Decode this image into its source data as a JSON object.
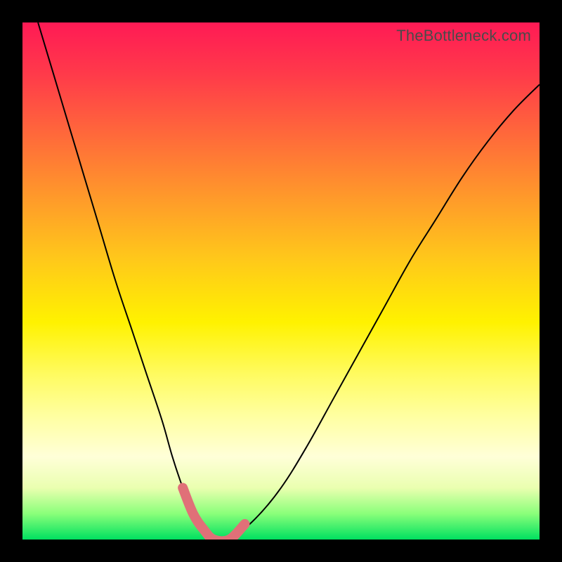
{
  "watermark": "TheBottleneck.com",
  "chart_data": {
    "type": "line",
    "title": "",
    "xlabel": "",
    "ylabel": "",
    "xlim": [
      0,
      100
    ],
    "ylim": [
      0,
      100
    ],
    "series": [
      {
        "name": "bottleneck-curve",
        "x": [
          3,
          6,
          9,
          12,
          15,
          18,
          21,
          24,
          27,
          29,
          31,
          33,
          35,
          37,
          40,
          45,
          50,
          55,
          60,
          65,
          70,
          75,
          80,
          85,
          90,
          95,
          100
        ],
        "values": [
          100,
          90,
          80,
          70,
          60,
          50,
          41,
          32,
          23,
          16,
          10,
          5,
          2,
          0,
          0,
          4,
          10,
          18,
          27,
          36,
          45,
          54,
          62,
          70,
          77,
          83,
          88
        ]
      }
    ],
    "highlight": {
      "name": "optimal-range",
      "x": [
        31,
        33,
        35,
        37,
        40,
        43
      ],
      "values": [
        10,
        5,
        2,
        0,
        0,
        3
      ]
    }
  }
}
